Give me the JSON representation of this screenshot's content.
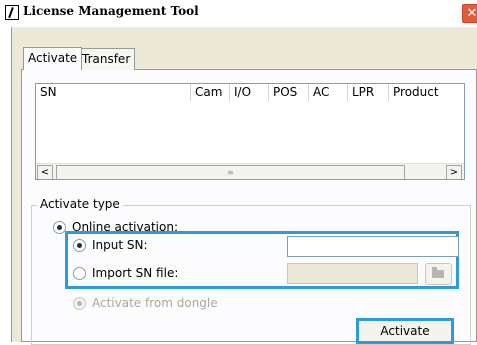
{
  "window": {
    "title": "License Management Tool",
    "close_glyph": "✕"
  },
  "tabs": [
    {
      "label": "Activate",
      "active": true
    },
    {
      "label": "Transfer",
      "active": false
    }
  ],
  "table": {
    "columns": [
      "SN",
      "Cam",
      "I/O",
      "POS",
      "AC",
      "LPR",
      "Product"
    ],
    "rows": []
  },
  "scrollbar": {
    "left_arrow": "<",
    "right_arrow": ">",
    "thumb_grip": "≡"
  },
  "activate_type": {
    "group_label": "Activate type",
    "online_activation": "Online activation:",
    "input_sn": "Input SN:",
    "input_sn_value": "",
    "import_sn_file": "Import SN file:",
    "import_sn_file_value": "",
    "activate_from_dongle": "Activate from dongle"
  },
  "buttons": {
    "activate": "Activate"
  },
  "colors": {
    "highlight": "#2f9ad8",
    "dialog_bg": "#ece9d8",
    "panel_bg": "#fcfcfe",
    "close_button": "#e25b3a"
  },
  "icons": {
    "app": "app-icon",
    "close": "close-icon",
    "browse": "folder-icon"
  }
}
